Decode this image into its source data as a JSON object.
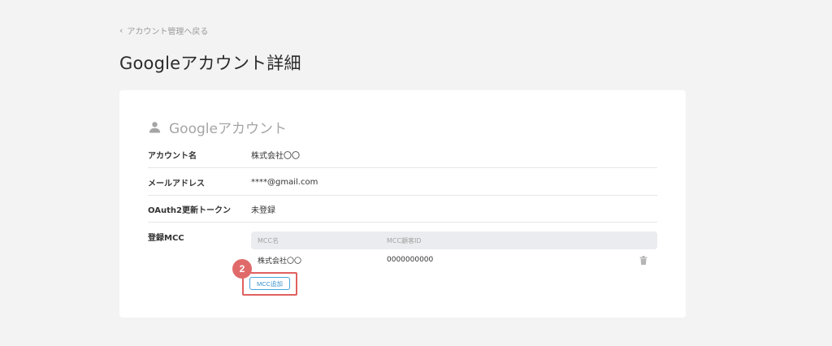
{
  "breadcrumb": {
    "chevron": "‹",
    "label": "アカウント管理へ戻る"
  },
  "page": {
    "title": "Googleアカウント詳細"
  },
  "section": {
    "icon": "person-icon",
    "title": "Googleアカウント"
  },
  "fields": [
    {
      "label": "アカウント名",
      "value": "株式会社〇〇"
    },
    {
      "label": "メールアドレス",
      "value": "****@gmail.com"
    },
    {
      "label": "OAuth2更新トークン",
      "value": "未登録"
    }
  ],
  "mcc": {
    "label": "登録MCC",
    "columns": [
      "MCC名",
      "MCC顧客ID"
    ],
    "rows": [
      {
        "name": "株式会社〇〇",
        "id": "0000000000"
      }
    ],
    "add_button": "MCC追加"
  },
  "annotation": {
    "step": "2",
    "color": "#e06a6a"
  },
  "colors": {
    "accent": "#4aa3df",
    "highlight": "#e06060",
    "background": "#f3f3f4"
  }
}
